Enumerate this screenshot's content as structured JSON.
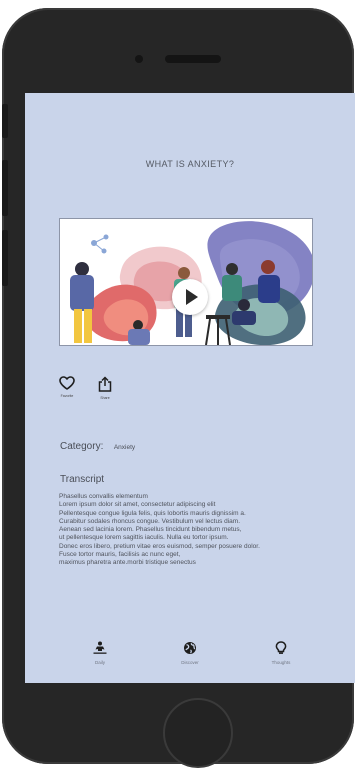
{
  "screen": {
    "title": "WHAT IS ANXIETY?",
    "background_color": "#c9d4ea"
  },
  "video": {
    "thumbnail_icon": "people-illustration",
    "play_icon": "play-icon"
  },
  "actions": [
    {
      "label": "Favorite",
      "icon": "heart-icon"
    },
    {
      "label": "Share",
      "icon": "share-icon"
    }
  ],
  "category": {
    "label": "Category:",
    "value": "Anxiety"
  },
  "transcript": {
    "heading": "Transcript",
    "lines": [
      "Phasellus convallis elementum",
      "Lorem ipsum dolor sit amet, consectetur adipiscing elit",
      "Pellentesque congue ligula felis, quis lobortis mauris dignissim a.",
      "Curabitur sodales rhoncus congue. Vestibulum vel lectus diam.",
      "Aenean sed lacinia lorem. Phasellus tincidunt bibendum metus,",
      "ut pellentesque lorem sagittis iaculis. Nulla eu tortor ipsum.",
      "Donec eros libero, pretium vitae eros euismod, semper posuere dolor.",
      "Fusce tortor mauris, facilisis ac nunc eget,",
      "maximus pharetra ante.morbi tristique senectus"
    ]
  },
  "tabbar": {
    "tabs": [
      {
        "label": "Daily",
        "icon": "meditation-icon"
      },
      {
        "label": "Discover",
        "icon": "globe-icon"
      },
      {
        "label": "Thoughts",
        "icon": "lightbulb-icon"
      }
    ]
  }
}
